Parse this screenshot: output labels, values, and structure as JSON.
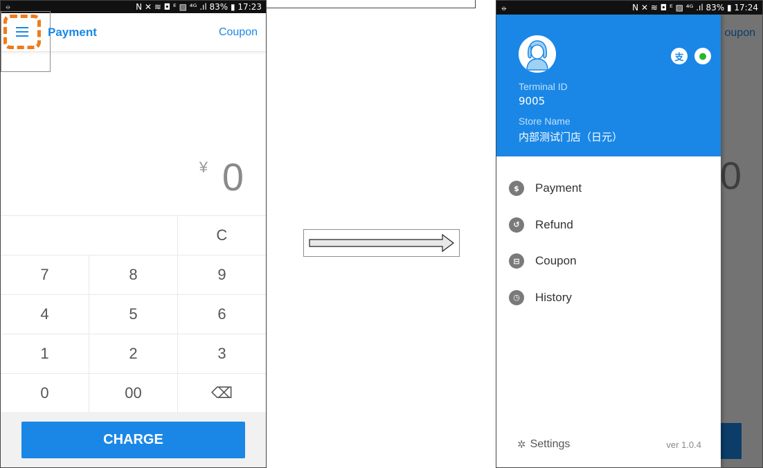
{
  "left_screen": {
    "status": {
      "left": "⦵",
      "right": "N ✕ ≋ ◘ ᴱ ▨ ⁴ᴳ .ıl 83% ▮ 17:23"
    },
    "appbar": {
      "title": "Payment",
      "coupon": "Coupon"
    },
    "amount": {
      "currency": "¥",
      "value": "0"
    },
    "keypad": [
      [
        "",
        "C"
      ],
      [
        "7",
        "8",
        "9"
      ],
      [
        "4",
        "5",
        "6"
      ],
      [
        "1",
        "2",
        "3"
      ],
      [
        "0",
        "00",
        "⌫"
      ]
    ],
    "charge_label": "CHARGE"
  },
  "right_screen": {
    "status": {
      "left": "⦵",
      "right": "N ✕ ≋ ◘ ᴱ ▨ ⁴ᴳ .ıl 83% ▮ 17:24"
    },
    "background": {
      "coupon": "oupon",
      "amount": "0"
    },
    "drawer": {
      "terminal_label": "Terminal ID",
      "terminal_value": "9005",
      "store_label": "Store Name",
      "store_value": "内部测试门店（日元）",
      "pay_icons": [
        {
          "name": "alipay-icon",
          "glyph": "支",
          "color": "#1a87e6"
        },
        {
          "name": "wechat-icon",
          "glyph": "●",
          "color": "#2bb52b"
        }
      ],
      "menu": [
        {
          "label": "Payment",
          "icon": "dollar-icon",
          "glyph": "$"
        },
        {
          "label": "Refund",
          "icon": "refund-icon",
          "glyph": "↺"
        },
        {
          "label": "Coupon",
          "icon": "coupon-icon",
          "glyph": "⊟"
        },
        {
          "label": "History",
          "icon": "history-icon",
          "glyph": "◷"
        }
      ],
      "settings": "Settings",
      "version": "ver 1.0.4"
    }
  },
  "colors": {
    "accent": "#1a87e6",
    "highlight": "#f07a1a"
  }
}
